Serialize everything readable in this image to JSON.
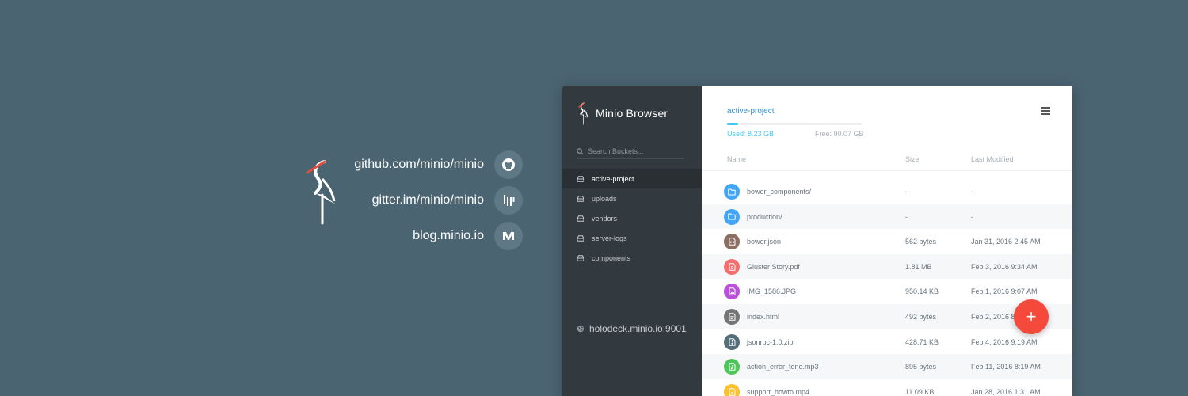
{
  "promo": {
    "links": [
      {
        "text": "github.com/minio/minio",
        "icon": "github-icon"
      },
      {
        "text": "gitter.im/minio/minio",
        "icon": "gitter-icon"
      },
      {
        "text": "blog.minio.io",
        "icon": "medium-icon"
      }
    ]
  },
  "sidebar": {
    "brand": "Minio Browser",
    "search_placeholder": "Search Buckets...",
    "buckets": [
      "active-project",
      "uploads",
      "vendors",
      "server-logs",
      "components"
    ],
    "active_bucket": "active-project",
    "host": "holodeck.minio.io:9001"
  },
  "main": {
    "bucket_name": "active-project",
    "used": "Used: 8.23 GB",
    "free": "Free: 90.07 GB",
    "usage_fraction": 0.08,
    "columns": {
      "name": "Name",
      "size": "Size",
      "modified": "Last Modified"
    },
    "files": [
      {
        "name": "bower_components/",
        "size": "-",
        "modified": "-",
        "type": "folder",
        "color": "#42a5f5"
      },
      {
        "name": "production/",
        "size": "-",
        "modified": "-",
        "type": "folder",
        "color": "#42a5f5"
      },
      {
        "name": "bower.json",
        "size": "562 bytes",
        "modified": "Jan 31, 2016 2:45 AM",
        "type": "code",
        "color": "#8d6e63"
      },
      {
        "name": "Gluster Story.pdf",
        "size": "1.81 MB",
        "modified": "Feb 3, 2016 9:34 AM",
        "type": "pdf",
        "color": "#f46e6e"
      },
      {
        "name": "IMG_1586.JPG",
        "size": "950.14 KB",
        "modified": "Feb 1, 2016 9:07 AM",
        "type": "image",
        "color": "#ba52d9"
      },
      {
        "name": "index.html",
        "size": "492 bytes",
        "modified": "Feb 2, 2016 8",
        "type": "text",
        "color": "#757575"
      },
      {
        "name": "jsonrpc-1.0.zip",
        "size": "428.71 KB",
        "modified": "Feb 4, 2016 9:19 AM",
        "type": "zip",
        "color": "#546e7a"
      },
      {
        "name": "action_error_tone.mp3",
        "size": "895 bytes",
        "modified": "Feb 11, 2016 8:19 AM",
        "type": "audio",
        "color": "#4fc65a"
      },
      {
        "name": "support_howto.mp4",
        "size": "11.09 KB",
        "modified": "Jan 28, 2016 1:31 AM",
        "type": "video",
        "color": "#fbc02d"
      }
    ]
  },
  "fab": {
    "label": "+"
  },
  "colors": {
    "background": "#4b6472",
    "sidebar": "#32393f",
    "accent": "#46c9f0",
    "fab": "#f4493b"
  }
}
